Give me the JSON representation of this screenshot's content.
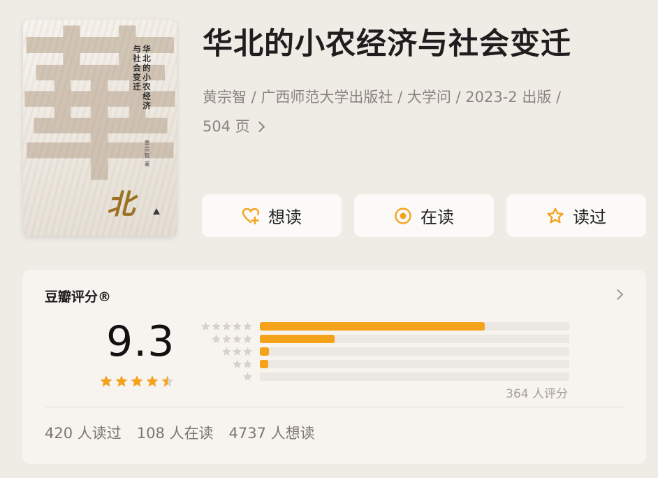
{
  "book": {
    "title": "华北的小农经济与社会变迁",
    "meta_line1": "黄宗智 / 广西师范大学出版社 / 大学问 / 2023-2 出版 /",
    "meta_pages": "504 页",
    "cover": {
      "big_char": "華",
      "vertical_title_1": "华北的小农经济",
      "vertical_title_2": "与社会变迁",
      "author": "黄宗智 著",
      "bei": "北"
    }
  },
  "actions": [
    {
      "label": "想读",
      "icon": "heart-plus-icon"
    },
    {
      "label": "在读",
      "icon": "target-circle-icon"
    },
    {
      "label": "读过",
      "icon": "star-outline-icon"
    }
  ],
  "rating": {
    "label": "豆瓣评分®",
    "score": "9.3",
    "stars_value": 4.5,
    "rating_count": "364 人评分",
    "distribution": [
      {
        "stars": 5,
        "fraction": 0.727
      },
      {
        "stars": 4,
        "fraction": 0.242
      },
      {
        "stars": 3,
        "fraction": 0.03
      },
      {
        "stars": 2,
        "fraction": 0.027
      },
      {
        "stars": 1,
        "fraction": 0.0
      }
    ],
    "stats": {
      "read": "420 人读过",
      "reading": "108 人在读",
      "want": "4737 人想读"
    }
  },
  "colors": {
    "accent": "#f5a21b",
    "background": "#efebe5",
    "card": "#f7f4f0"
  }
}
